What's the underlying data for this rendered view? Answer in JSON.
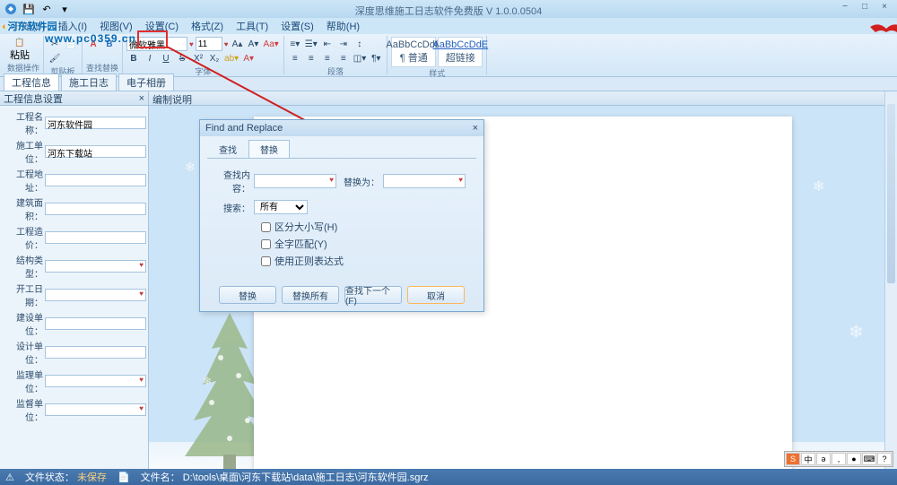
{
  "app": {
    "title": "深度思维施工日志软件免费版 V 1.0.0.0504"
  },
  "menubar": {
    "items": [
      "开始(B)",
      "插入(I)",
      "视图(V)",
      "设置(C)",
      "格式(Z)",
      "工具(T)",
      "设置(S)",
      "帮助(H)"
    ]
  },
  "ribbon": {
    "paste": "粘贴",
    "group_clipboard": "剪贴板",
    "group_data": "数据操作",
    "group_find": "查找替换",
    "font_name": "微软雅黑",
    "font_size": "11",
    "group_font": "字体",
    "group_paragraph": "段落",
    "style_preview": "AaBbCcDdE",
    "style_normal": "¶ 普通",
    "style_link": "超链接",
    "group_style": "样式"
  },
  "doc_tabs": {
    "tab1": "工程信息",
    "tab2": "施工日志",
    "tab3": "电子相册"
  },
  "left_panel": {
    "header": "工程信息设置",
    "fields": [
      {
        "label": "工程名称：",
        "value": "河东软件园",
        "dd": false
      },
      {
        "label": "施工单位：",
        "value": "河东下载站",
        "dd": false
      },
      {
        "label": "工程地址：",
        "value": "",
        "dd": false
      },
      {
        "label": "建筑面积：",
        "value": "",
        "dd": false
      },
      {
        "label": "工程造价：",
        "value": "",
        "dd": false
      },
      {
        "label": "结构类型：",
        "value": "",
        "dd": true
      },
      {
        "label": "开工日期：",
        "value": "",
        "dd": true
      },
      {
        "label": "建设单位：",
        "value": "",
        "dd": false
      },
      {
        "label": "设计单位：",
        "value": "",
        "dd": false
      },
      {
        "label": "监理单位：",
        "value": "",
        "dd": true
      },
      {
        "label": "监督单位：",
        "value": "",
        "dd": true
      }
    ]
  },
  "right_header": "编制说明",
  "dialog": {
    "title": "Find and Replace",
    "tab_find": "查找",
    "tab_replace": "替换",
    "find_label": "查找内容：",
    "replace_label": "替换为：",
    "search_label": "搜索：",
    "search_value": "所有",
    "opt_case": "区分大小写(H)",
    "opt_whole": "全字匹配(Y)",
    "opt_regex": "使用正则表达式",
    "btn_replace": "替换",
    "btn_replace_all": "替换所有",
    "btn_find_next": "查找下一个(F)",
    "btn_cancel": "取消"
  },
  "status": {
    "file_status_label": "文件状态：",
    "file_status": "未保存",
    "file_name_label": "文件名：",
    "file_name": "D:\\tools\\桌面\\河东下载站\\data\\施工日志\\河东软件园.sgrz"
  },
  "watermark": {
    "brand_a": "河东",
    "brand_b": "软件园",
    "url": "www.pc0359.cn"
  },
  "ime": {
    "items": [
      "中",
      "ə",
      ",",
      "●",
      "⌨",
      "?"
    ]
  }
}
